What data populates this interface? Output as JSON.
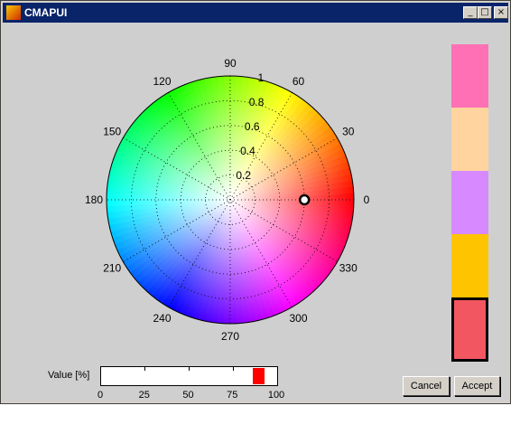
{
  "window": {
    "title": "CMAPUI",
    "controls": {
      "minimize": "_",
      "maximize": "□",
      "close": "×"
    }
  },
  "polar": {
    "angle_labels": [
      "0",
      "30",
      "60",
      "90",
      "120",
      "150",
      "180",
      "210",
      "240",
      "270",
      "300",
      "330"
    ],
    "radius_labels": [
      "0.2",
      "0.4",
      "0.6",
      "0.8",
      "1"
    ],
    "marker": {
      "angle_deg": 0,
      "radius": 0.6
    }
  },
  "chips": [
    {
      "color": "#ff70b4",
      "selected": false
    },
    {
      "color": "#ffd49f",
      "selected": false
    },
    {
      "color": "#d78aff",
      "selected": false
    },
    {
      "color": "#ffc400",
      "selected": false
    },
    {
      "color": "#f25660",
      "selected": true
    }
  ],
  "value_slider": {
    "label": "Value [%]",
    "min": 0,
    "max": 100,
    "value": 90,
    "tick_labels": [
      "0",
      "25",
      "50",
      "75",
      "100"
    ],
    "thumb_color": "#ff0000"
  },
  "buttons": {
    "cancel": "Cancel",
    "accept": "Accept"
  }
}
